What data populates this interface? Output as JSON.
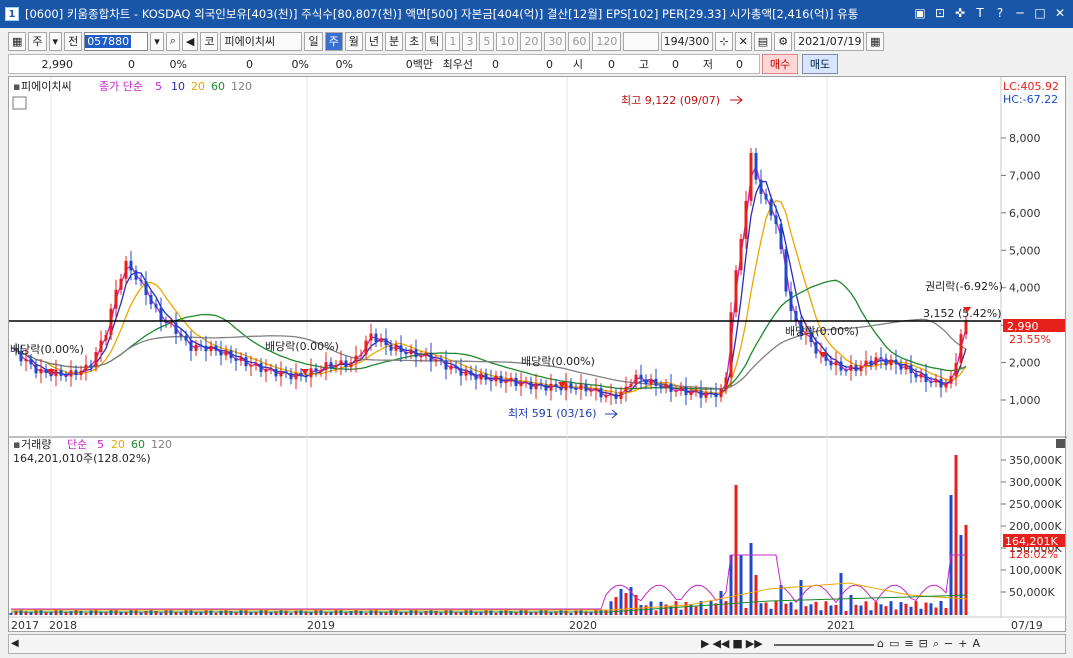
{
  "window": {
    "number": "1",
    "title": "[0600] 키움종합차트 - KOSDAQ 외국인보유[403(천)] 주식수[80,807(천)] 액면[500] 자본금[404(억)] 결산[12월] EPS[102] PER[29.33] 시가총액[2,416(억)] 유통"
  },
  "toolbar": {
    "market": "주",
    "prev": "전",
    "code": "057880",
    "fav": "코",
    "stock_name": "피에이치씨",
    "periods": [
      "일",
      "주",
      "월",
      "년",
      "분",
      "초",
      "틱"
    ],
    "active_period": "주",
    "tick_options": [
      "1",
      "3",
      "5",
      "10",
      "20",
      "30",
      "60",
      "120"
    ],
    "count": "194",
    "max_count": "/300",
    "date": "2021/07/19"
  },
  "infobar": {
    "price": "2,990",
    "change": "0",
    "rate": "0%",
    "volume": "0",
    "vol_rate": "0%",
    "amount_rate": "0%",
    "amount": "0백만",
    "best_ask_label": "최우선",
    "best_ask": "0",
    "best_bid": "0",
    "open_label": "시",
    "open": "0",
    "high_label": "고",
    "high": "0",
    "low_label": "저",
    "low": "0"
  },
  "buttons": {
    "buy": "매수",
    "sell": "매도"
  },
  "colors": {
    "up": "#e8201b",
    "down": "#1f49c9",
    "ma5": "#c726c7",
    "ma10": "#2a2ac0",
    "ma20": "#e8a800",
    "ma60": "#1d8a2a",
    "ma120": "#808080",
    "title_bg": "#1a56a8"
  },
  "price_panel": {
    "legend_name": "피에이치씨",
    "legend_type": "종가 단순",
    "ma_labels": [
      "5",
      "10",
      "20",
      "60",
      "120"
    ],
    "lc": "LC:405.92",
    "hc": "HC:-67.22",
    "current_price": "2,990",
    "current_rate": "23.55%",
    "y_ticks": [
      "8,000",
      "7,000",
      "6,000",
      "5,000",
      "4,000",
      "3,000",
      "2,000",
      "1,000"
    ],
    "annotations": {
      "high": "최고 9,122 (09/07)",
      "low": "최저 591 (03/16)",
      "rights": "권리락(-6.92%)",
      "ref_line": "3,152 (5.42%)",
      "div1": "배당락(0.00%)",
      "div2": "배당락(0.00%)",
      "div3": "배당락(0.00%)",
      "div4": "배당락(0.00%)"
    }
  },
  "volume_panel": {
    "legend_name": "거래량",
    "legend_type": "단순",
    "ma_labels": [
      "5",
      "20",
      "60",
      "120"
    ],
    "current_text": "164,201,010주(128.02%)",
    "current_value": "164,201K",
    "current_rate": "128.02%",
    "y_ticks": [
      "350,000K",
      "300,000K",
      "250,000K",
      "200,000K",
      "150,000K",
      "100,000K",
      "50,000K"
    ]
  },
  "x_axis": {
    "labels": [
      "2017",
      "2018",
      "2019",
      "2020",
      "2021",
      "07/19"
    ]
  }
}
